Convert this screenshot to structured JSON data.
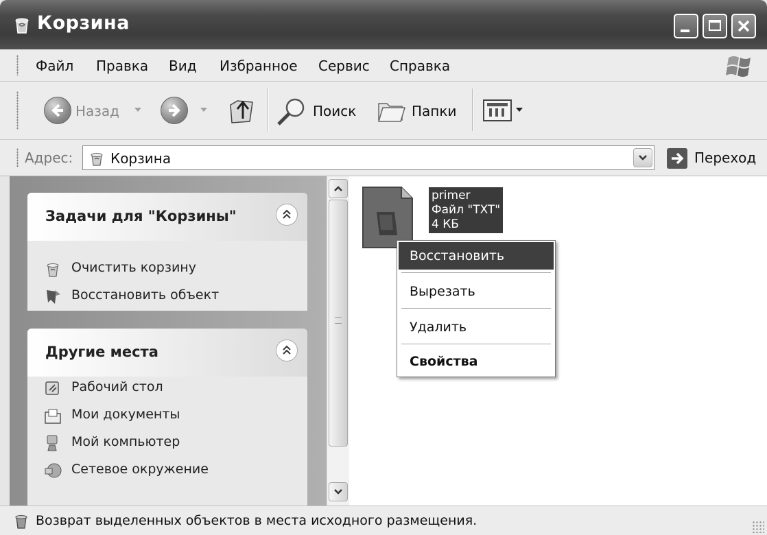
{
  "window": {
    "title": "Корзина"
  },
  "menu": [
    "Файл",
    "Правка",
    "Вид",
    "Избранное",
    "Сервис",
    "Справка"
  ],
  "toolbar": {
    "back_label": "Назад",
    "search_label": "Поиск",
    "folders_label": "Папки"
  },
  "address": {
    "label": "Адрес:",
    "value": "Корзина",
    "go_label": "Переход"
  },
  "tasks_panel": {
    "title": "Задачи для \"Корзины\"",
    "items": [
      {
        "label": "Очистить корзину",
        "icon": "recycle-bin-icon"
      },
      {
        "label": "Восстановить объект",
        "icon": "restore-icon"
      }
    ]
  },
  "places_panel": {
    "title": "Другие места",
    "items": [
      {
        "label": "Рабочий стол",
        "icon": "desktop-icon"
      },
      {
        "label": "Мои документы",
        "icon": "my-documents-icon"
      },
      {
        "label": "Мой компьютер",
        "icon": "my-computer-icon"
      },
      {
        "label": "Сетевое окружение",
        "icon": "network-icon"
      }
    ]
  },
  "file": {
    "name": "primer",
    "type": "Файл \"TXT\"",
    "size": "4 КБ"
  },
  "context_menu": {
    "items": [
      {
        "label": "Восстановить",
        "selected": true
      },
      {
        "label": "Вырезать"
      },
      {
        "label": "Удалить"
      },
      {
        "label": "Свойства",
        "bold": true
      }
    ]
  },
  "status": {
    "text": "Возврат выделенных объектов в места исходного размещения."
  }
}
